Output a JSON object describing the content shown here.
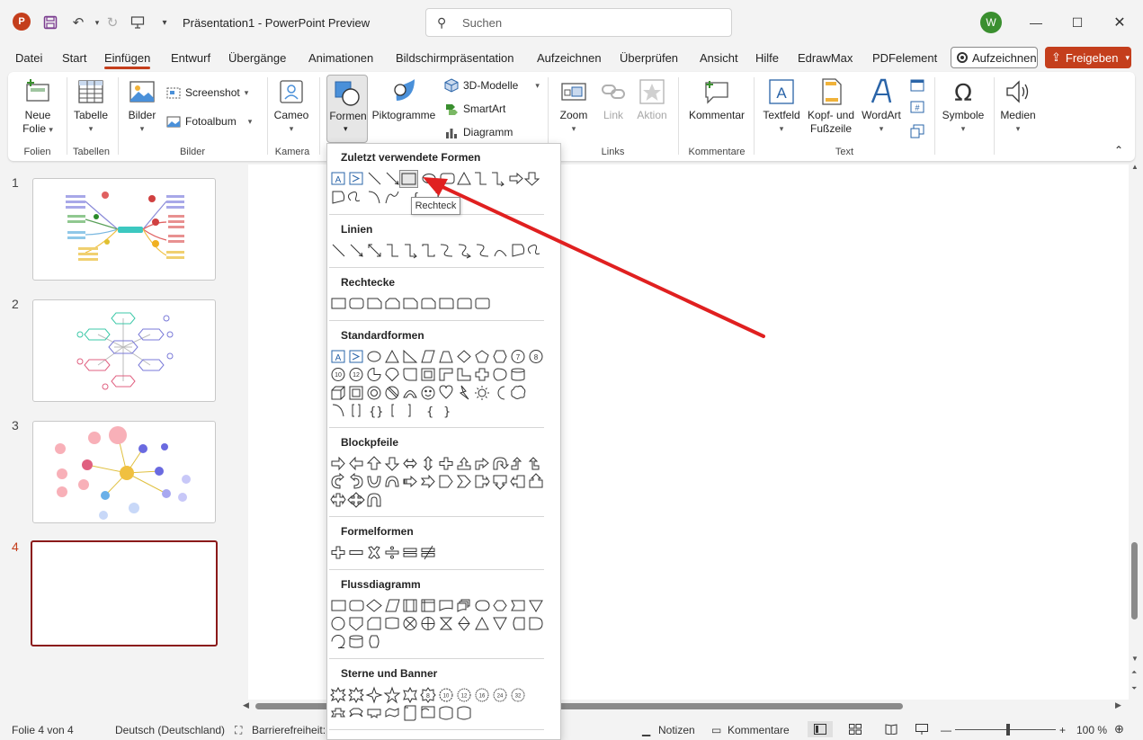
{
  "titlebar": {
    "title": "Präsentation1  -  PowerPoint Preview",
    "search_placeholder": "Suchen",
    "avatar_initial": "W"
  },
  "menu": {
    "tabs": [
      "Datei",
      "Start",
      "Einfügen",
      "Entwurf",
      "Übergänge",
      "Animationen",
      "Bildschirmpräsentation",
      "Aufzeichnen",
      "Überprüfen",
      "Ansicht",
      "Hilfe",
      "EdrawMax",
      "PDFelement"
    ],
    "active_tab": "Einfügen",
    "record_label": "Aufzeichnen",
    "share_label": "Freigeben"
  },
  "ribbon": {
    "new_slide": "Neue\nFolie",
    "table": "Tabelle",
    "pictures": "Bilder",
    "screenshot": "Screenshot",
    "photo_album": "Fotoalbum",
    "cameo": "Cameo",
    "shapes": "Formen",
    "icons": "Piktogramme",
    "models_3d": "3D-Modelle",
    "smartart": "SmartArt",
    "chart": "Diagramm",
    "zoom": "Zoom",
    "link": "Link",
    "action": "Aktion",
    "comment": "Kommentar",
    "textbox": "Textfeld",
    "header_footer_1": "Kopf- und",
    "header_footer_2": "Fußzeile",
    "wordart": "WordArt",
    "symbols": "Symbole",
    "media": "Medien",
    "groups": {
      "slides": "Folien",
      "tables": "Tabellen",
      "images": "Bilder",
      "camera": "Kamera",
      "links": "Links",
      "comments": "Kommentare",
      "text": "Text"
    }
  },
  "slides": {
    "numbers": [
      "1",
      "2",
      "3",
      "4"
    ],
    "active": "4"
  },
  "shapes_panel": {
    "sections": [
      "Zuletzt verwendete Formen",
      "Linien",
      "Rechtecke",
      "Standardformen",
      "Blockpfeile",
      "Formelformen",
      "Flussdiagramm",
      "Sterne und Banner"
    ],
    "tooltip": "Rechteck"
  },
  "statusbar": {
    "slide_info": "Folie 4 von 4",
    "language": "Deutsch (Deutschland)",
    "accessibility": "Barrierefreiheit: G",
    "notes": "Notizen",
    "comments": "Kommentare",
    "zoom": "100 %"
  },
  "colors": {
    "accent": "#c43e1c",
    "arrow": "#e02020",
    "active_slide_border": "#8b1a1a"
  }
}
